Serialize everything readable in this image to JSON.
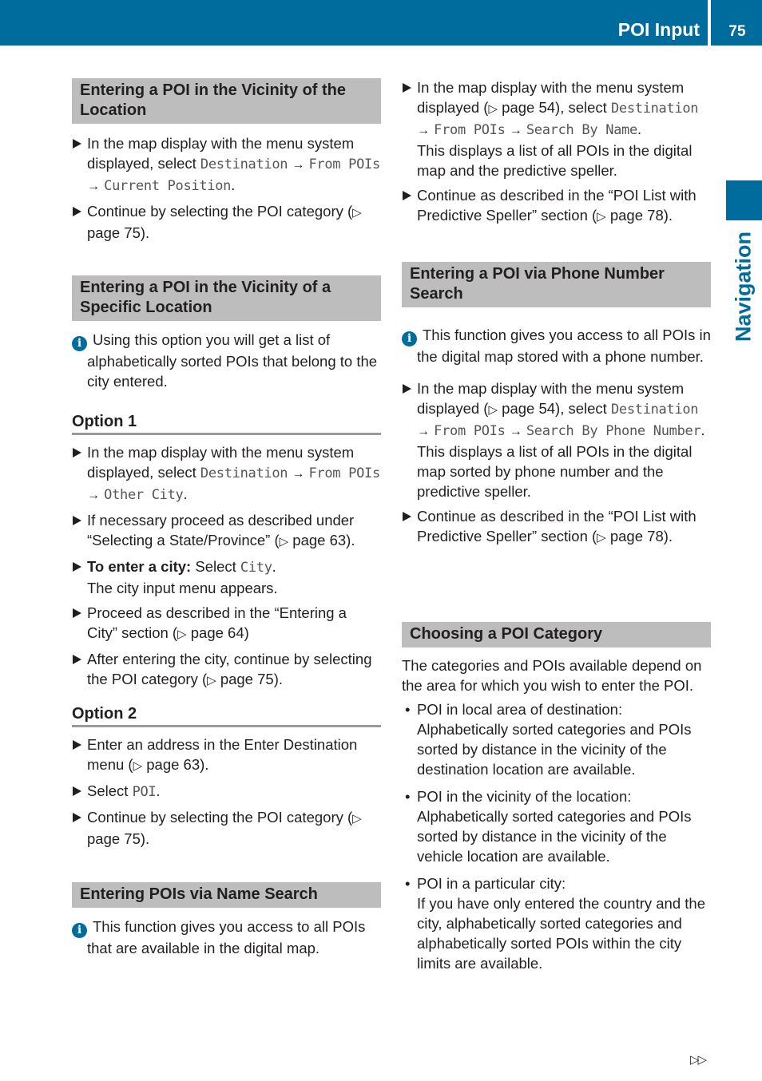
{
  "header": {
    "title": "POI Input",
    "page_number": "75",
    "accent_color": "#006b9d"
  },
  "side_tab": {
    "label": "Navigation"
  },
  "left": {
    "s1": {
      "heading": "Entering a POI in the Vicinity of the Location",
      "item1": {
        "text": "In the map display with the menu system displayed, select ",
        "m1": "Destination",
        "m2": "From POIs",
        "m3": "Current Position",
        "end": "."
      },
      "item2": {
        "text": "Continue by selecting the POI category (",
        "ref": "page 75",
        "end": ")."
      }
    },
    "s2": {
      "heading": "Entering a POI in the Vicinity of a Specific Location",
      "info": "Using this option you will get a list of alphabetically sorted POIs that belong to the city entered."
    },
    "opt1": {
      "heading": "Option 1",
      "item1": {
        "text": "In the map display with the menu system displayed, select ",
        "m1": "Destination",
        "m2": "From POIs",
        "m3": "Other City",
        "end": "."
      },
      "item2": {
        "text": "If necessary proceed as described under “Selecting a State/Province” (",
        "ref": "page 63",
        "end": ")."
      },
      "item3": {
        "bold": "To enter a city:",
        "text": " Select ",
        "m1": "City",
        "end": ".",
        "line2": "The city input menu appears."
      },
      "item4": {
        "text": "Proceed as described in the “Entering a City” section (",
        "ref": "page 64",
        "end": ")"
      },
      "item5": {
        "text": "After entering the city, continue by selecting the POI category (",
        "ref": "page 75",
        "end": ")."
      }
    },
    "opt2": {
      "heading": "Option 2",
      "item1": {
        "text": "Enter an address in the Enter Destination menu (",
        "ref": "page 63",
        "end": ")."
      },
      "item2": {
        "text": "Select ",
        "m1": "POI",
        "end": "."
      },
      "item3": {
        "text": "Continue by selecting the POI category (",
        "ref": "page 75",
        "end": ")."
      }
    },
    "s3": {
      "heading": "Entering POIs via Name Search",
      "info": "This function gives you access to all POIs that are available in the digital map."
    }
  },
  "right": {
    "name_search": {
      "item1": {
        "text": "In the map display with the menu system displayed (",
        "ref": "page 54",
        "mid": "), select ",
        "m1": "Destination",
        "m2": "From POIs",
        "m3": "Search By Name",
        "end": ".",
        "line2": "This displays a list of all POIs in the digital map and the predictive speller."
      },
      "item2": {
        "text": "Continue as described in the “POI List with Predictive Speller” section (",
        "ref": "page 78",
        "end": ")."
      }
    },
    "s4": {
      "heading": "Entering a POI via Phone Number Search",
      "info": "This function gives you access to all POIs in the digital map stored with a phone number.",
      "item1": {
        "text": "In the map display with the menu system displayed (",
        "ref": "page 54",
        "mid": "), select ",
        "m1": "Destination",
        "m2": "From POIs",
        "m3": "Search By Phone Number",
        "end": ".",
        "line2": "This displays a list of all POIs in the digital map sorted by phone number and the predictive speller."
      },
      "item2": {
        "text": "Continue as described in the “POI List with Predictive Speller” section (",
        "ref": "page 78",
        "end": ")."
      }
    },
    "s5": {
      "heading": "Choosing a POI Category",
      "intro": "The categories and POIs available depend on the area for which you wish to enter the POI.",
      "bullets": [
        {
          "title": "POI in local area of destination:",
          "text": "Alphabetically sorted categories and POIs sorted by distance in the vicinity of the destination location are available."
        },
        {
          "title": "POI in the vicinity of the location:",
          "text": "Alphabetically sorted categories and POIs sorted by distance in the vicinity of the vehicle location are available."
        },
        {
          "title": "POI in a particular city:",
          "text": "If you have only entered the country and the city, alphabetically sorted categories and alphabetically sorted POIs within the city limits are available."
        }
      ]
    }
  },
  "footer": {
    "continued_marker": "▷▷"
  },
  "glyphs": {
    "arrow": "→",
    "ref_triangle": "▷",
    "bullet": "•",
    "info": "i"
  }
}
